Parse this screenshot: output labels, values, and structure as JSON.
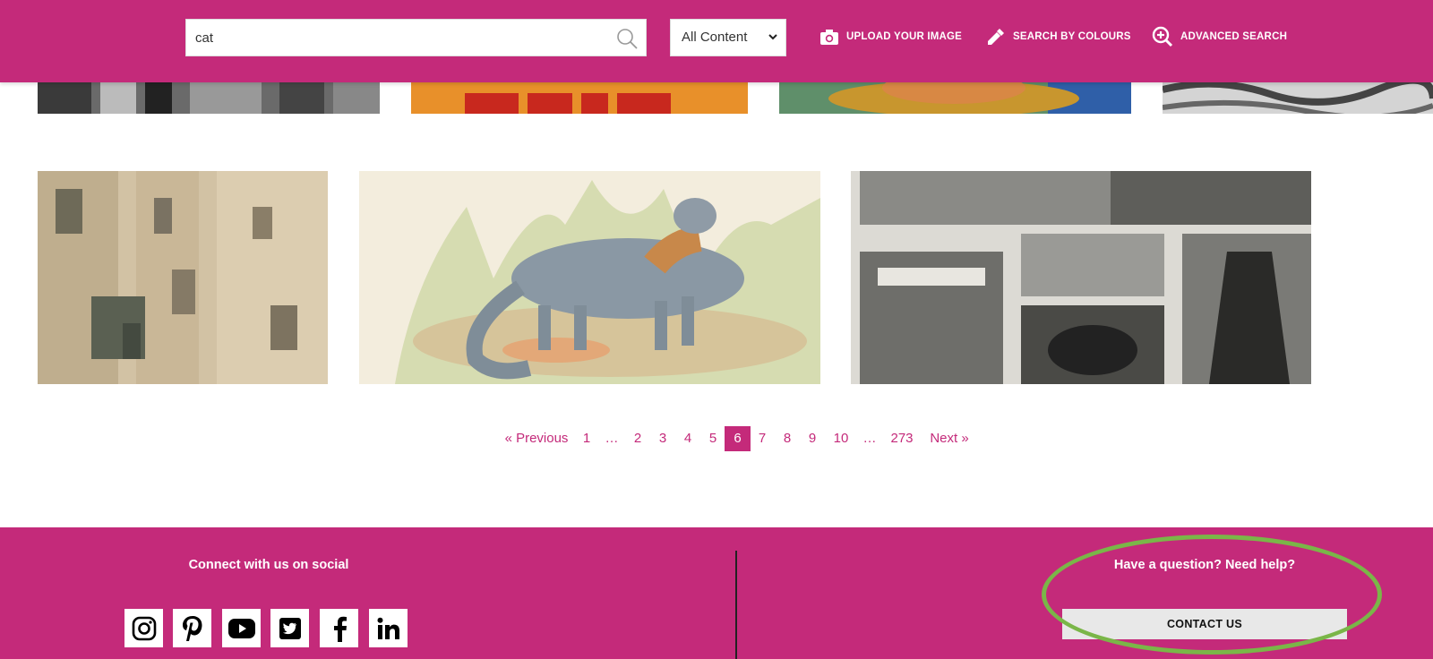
{
  "header": {
    "search_value": "cat",
    "search_placeholder": "",
    "content_select": "All Content",
    "upload_label": "UPLOAD YOUR IMAGE",
    "colours_label": "SEARCH BY COLOURS",
    "advanced_label": "ADVANCED SEARCH"
  },
  "pagination": {
    "previous": "« Previous",
    "next": "Next »",
    "pages": [
      "1",
      "…",
      "2",
      "3",
      "4",
      "5",
      "6",
      "7",
      "8",
      "9",
      "10",
      "…",
      "273"
    ],
    "current": "6"
  },
  "footer": {
    "social_heading": "Connect with us on social",
    "help_heading": "Have a question? Need help?",
    "contact_label": "CONTACT US",
    "social_icons": [
      "instagram-icon",
      "pinterest-icon",
      "youtube-icon",
      "twitter-icon",
      "facebook-icon",
      "linkedin-icon"
    ]
  },
  "colors": {
    "brand": "#c42a7a",
    "highlight": "#7ab648"
  }
}
